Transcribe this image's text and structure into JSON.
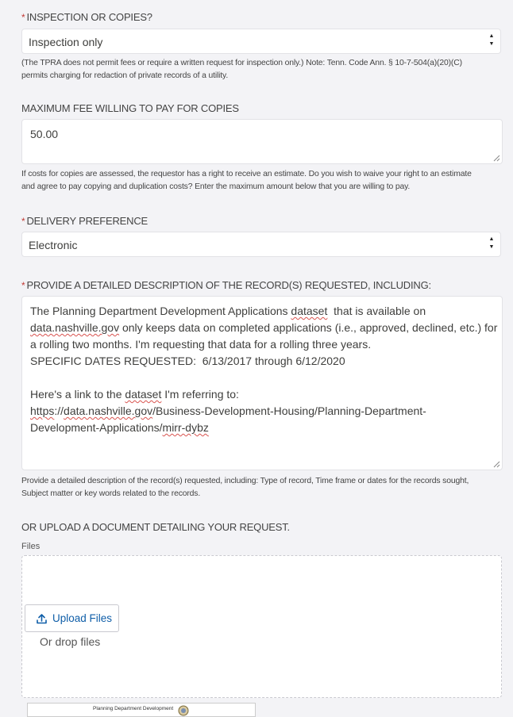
{
  "inspection": {
    "label": "INSPECTION OR COPIES?",
    "required_mark": "*",
    "value": "Inspection only",
    "help_line1": "(The TPRA does not permit fees or require a written request for inspection only.) Note: Tenn. Code Ann. § 10-7-504(a)(20)(C)",
    "help_line2": "permits charging for redaction of private records of a utility."
  },
  "max_fee": {
    "label": "MAXIMUM FEE WILLING TO PAY FOR COPIES",
    "value": "50.00",
    "help_line1": "If costs for copies are assessed, the requestor has a right to receive an estimate. Do you wish to waive your right to an estimate",
    "help_line2": "and agree to pay copying and duplication costs? Enter the maximum amount below that you are willing to pay."
  },
  "delivery": {
    "label": "DELIVERY PREFERENCE",
    "required_mark": "*",
    "value": "Electronic"
  },
  "description": {
    "label": "PROVIDE A DETAILED DESCRIPTION OF THE RECORD(S) REQUESTED, INCLUDING:",
    "required_mark": "*",
    "line1_a": "The Planning Department Development Applications ",
    "line1_b": "dataset",
    "line1_c": "  that is available on",
    "line2_a": "data.nashville.gov",
    "line2_b": " only keeps data on completed applications (i.e., approved, declined, etc.) for",
    "line3": "a rolling two months. I'm requesting that data for a rolling three years.",
    "line4": "SPECIFIC DATES REQUESTED:  6/13/2017 through 6/12/2020",
    "line5_a": "Here's a link to the ",
    "line5_b": "dataset",
    "line5_c": " I'm referring to:",
    "line6_a": "https",
    "line6_b": "://",
    "line6_c": "data.nashville.gov",
    "line6_d": "/Business-Development-Housing/Planning-Department-",
    "line7_a": "Development-Applications/",
    "line7_b": "mirr-dybz",
    "help_line1": "Provide a detailed description of the record(s) requested, including: Type of record, Time frame or dates for the records sought,",
    "help_line2": "Subject matter or key words related to the records."
  },
  "upload": {
    "heading": "OR UPLOAD A DOCUMENT DETAILING YOUR REQUEST.",
    "files_label": "Files",
    "button_label": "Upload Files",
    "drop_text": "Or drop files",
    "thumbnail_text": "Planning Department Development"
  },
  "colors": {
    "required": "#c23934",
    "link_button": "#0f5ea8",
    "spellcheck": "#d9534f"
  },
  "icons": [
    "chevron-updown-icon",
    "resize-handle-icon",
    "upload-icon",
    "seal-icon"
  ]
}
